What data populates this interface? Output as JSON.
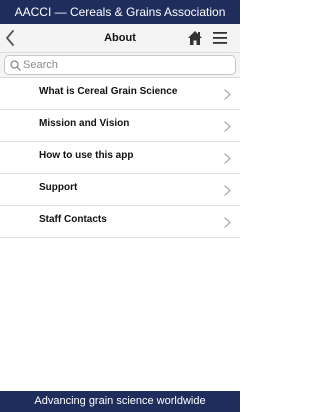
{
  "header": {
    "title": "AACCI — Cereals & Grains Association"
  },
  "nav": {
    "title": "About",
    "back_icon": "chevron-left-icon",
    "home_icon": "home-icon",
    "menu_icon": "hamburger-menu-icon"
  },
  "search": {
    "placeholder": "Search",
    "value": ""
  },
  "list": {
    "items": [
      {
        "label": "What is Cereal Grain Science"
      },
      {
        "label": "Mission and Vision"
      },
      {
        "label": "How to use this app"
      },
      {
        "label": "Support"
      },
      {
        "label": "Staff Contacts"
      }
    ]
  },
  "footer": {
    "text": "Advancing grain science worldwide"
  },
  "colors": {
    "brand_navy": "#1f2d5c",
    "nav_background": "#f4f4f4",
    "chevron_gray": "#b0b0b0"
  }
}
